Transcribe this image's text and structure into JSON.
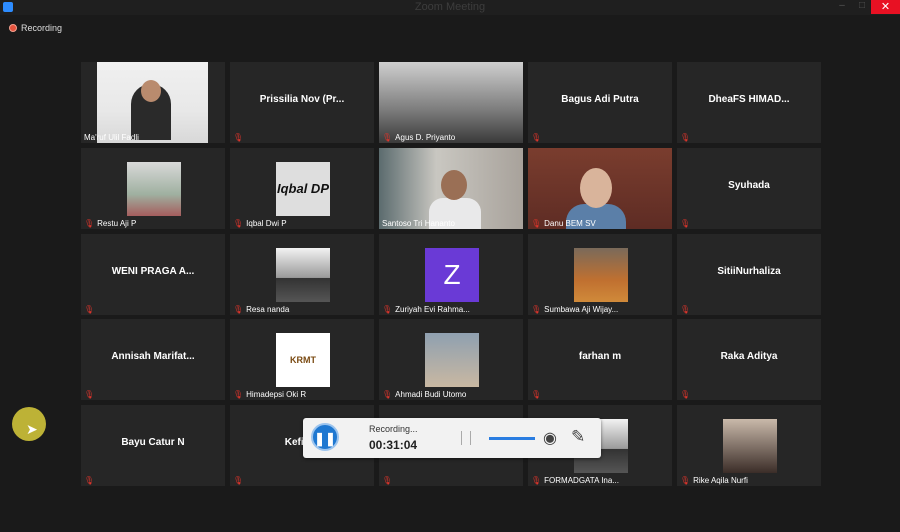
{
  "window": {
    "title": "Zoom Meeting",
    "min": "–",
    "max": "□",
    "close": "✕"
  },
  "recording_indicator": {
    "label": "Recording"
  },
  "participants": [
    {
      "name": "Ma'ruf Ulil Fadli",
      "type": "video",
      "muted": false
    },
    {
      "name": "Prissilia  Nov  (Pr...",
      "type": "name",
      "muted": true
    },
    {
      "name": "Agus D. Priyanto",
      "type": "video",
      "muted": true
    },
    {
      "name": "Bagus Adi Putra",
      "type": "name",
      "muted": true
    },
    {
      "name": "DheaFS  HIMAD...",
      "type": "name",
      "muted": true
    },
    {
      "name": "Restu Aji P",
      "type": "photo",
      "muted": true
    },
    {
      "name": "Iqbal Dwi P",
      "type": "photo",
      "muted": true,
      "avatar_text": "Iqbal DP"
    },
    {
      "name": "Santoso Tri Hananto",
      "type": "video",
      "muted": false,
      "speaking": true
    },
    {
      "name": "Danu BEM SV",
      "type": "video",
      "muted": true
    },
    {
      "name": "Syuhada",
      "type": "name",
      "muted": true
    },
    {
      "name": "WENI PRAGA A...",
      "type": "name",
      "muted": true
    },
    {
      "name": "Resa nanda",
      "type": "photo",
      "muted": true
    },
    {
      "name": "Zuriyah Evi Rahma...",
      "type": "photo",
      "muted": true,
      "avatar_text": "Z"
    },
    {
      "name": "Sumbawa Aji Wijay...",
      "type": "photo",
      "muted": true
    },
    {
      "name": "SitiiNurhaliza",
      "type": "name",
      "muted": true
    },
    {
      "name": "Annisah  Marifat...",
      "type": "name",
      "muted": true
    },
    {
      "name": "Himadepsi Oki R",
      "type": "photo",
      "muted": true,
      "avatar_text": "KRMT"
    },
    {
      "name": "Ahmadi Budi Utomo",
      "type": "photo",
      "muted": true
    },
    {
      "name": "farhan m",
      "type": "name",
      "muted": true
    },
    {
      "name": "Raka Aditya",
      "type": "name",
      "muted": true
    },
    {
      "name": "Bayu Catur N",
      "type": "name",
      "muted": true
    },
    {
      "name": "Kefi Ra",
      "type": "name",
      "muted": true
    },
    {
      "name": "",
      "type": "empty",
      "muted": true
    },
    {
      "name": "FORMADGATA Ina...",
      "type": "photo",
      "muted": true
    },
    {
      "name": "Rike Aqila Nurfi",
      "type": "photo",
      "muted": true
    }
  ],
  "recorder": {
    "status": "Recording...",
    "time": "00:31:04"
  },
  "colors": {
    "tile": "#262626",
    "speaker_highlight": "#e6e06a",
    "mute": "#e0342b",
    "accent": "#1f78d1"
  }
}
